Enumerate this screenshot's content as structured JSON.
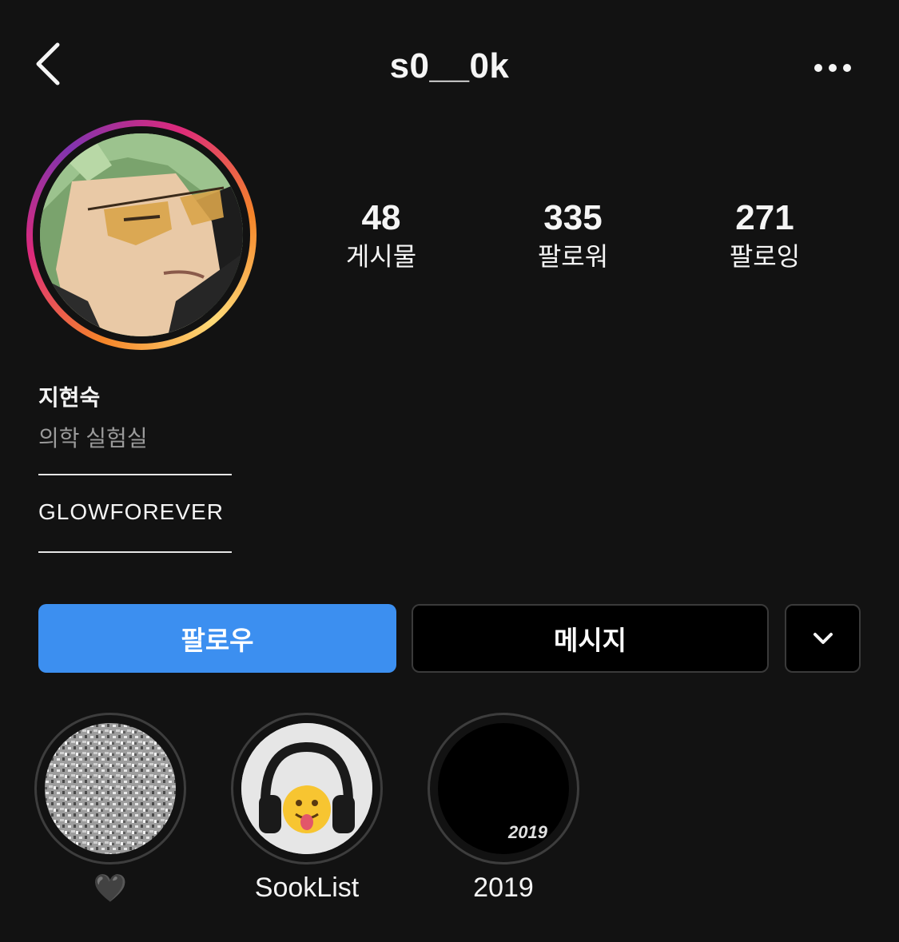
{
  "header": {
    "username": "s0__0k",
    "back_icon": "chevron-left-icon",
    "more_icon": "more-horizontal-icon"
  },
  "stats": [
    {
      "value": "48",
      "label": "게시물"
    },
    {
      "value": "335",
      "label": "팔로워"
    },
    {
      "value": "271",
      "label": "팔로잉"
    }
  ],
  "profile": {
    "name": "지현숙",
    "category": "의학 실험실",
    "bio_line": "GLOWFOREVER"
  },
  "actions": {
    "follow_label": "팔로우",
    "message_label": "메시지",
    "dropdown_icon": "chevron-down-icon",
    "follow_color": "#3c8ff0"
  },
  "highlights": [
    {
      "label": "🖤",
      "cover": "glitter-texture"
    },
    {
      "label": "SookList",
      "cover": "headphones-emoji"
    },
    {
      "label": "2019",
      "cover_text": "2019"
    }
  ],
  "colors": {
    "background": "#121212",
    "secondary_text": "#9a9a9a"
  }
}
